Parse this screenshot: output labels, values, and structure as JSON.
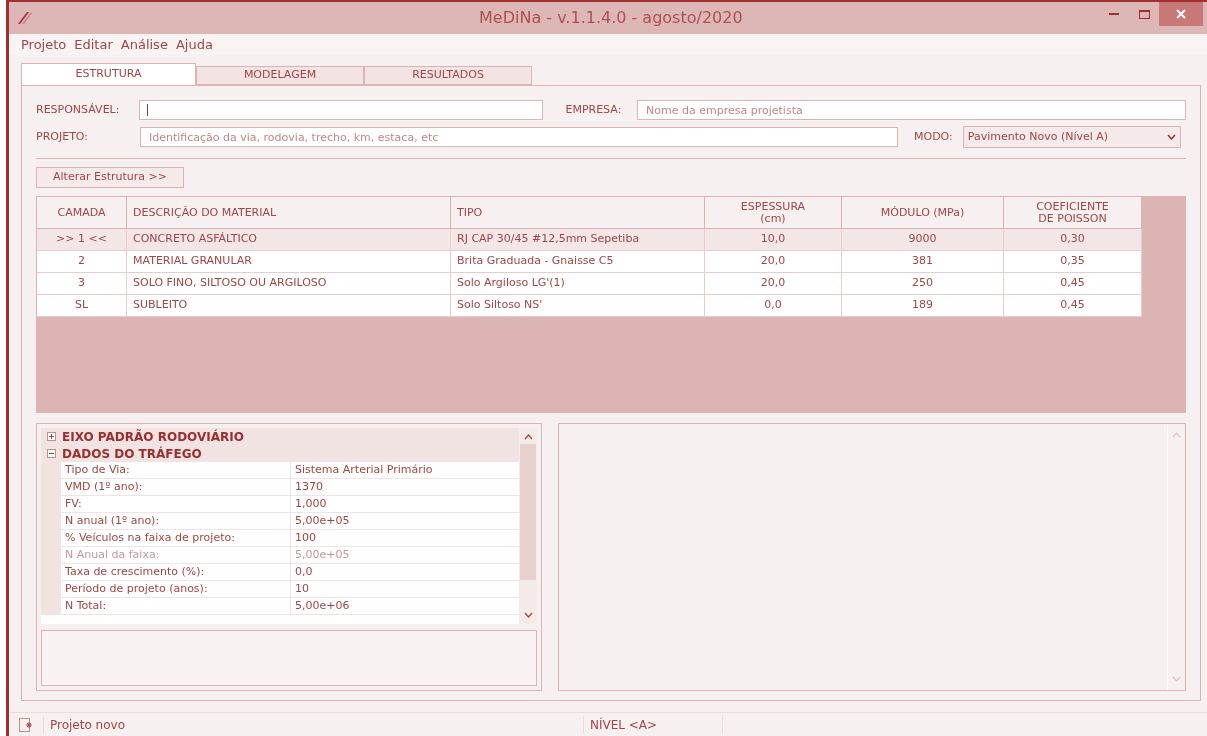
{
  "window": {
    "title": "MeDiNa - v.1.1.4.0 - agosto/2020"
  },
  "menu": [
    "Projeto",
    "Editar",
    "Análise",
    "Ajuda"
  ],
  "tabs": [
    {
      "label": "ESTRUTURA",
      "selected": true
    },
    {
      "label": "MODELAGEM",
      "selected": false
    },
    {
      "label": "RESULTADOS",
      "selected": false
    }
  ],
  "form": {
    "responsavel": {
      "label": "RESPONSÁVEL:"
    },
    "empresa": {
      "label": "EMPRESA:",
      "placeholder": "Nome da empresa projetista"
    },
    "projeto": {
      "label": "PROJETO:",
      "placeholder": "Identificação da via, rodovia, trecho, km, estaca, etc"
    },
    "modo": {
      "label": "MODO:",
      "value": "Pavimento Novo (Nível A)"
    }
  },
  "alter_button": "Alterar Estrutura >>",
  "table": {
    "columns": [
      {
        "label": "CAMADA"
      },
      {
        "label": "DESCRIÇÃO DO MATERIAL"
      },
      {
        "label": "TIPO"
      },
      {
        "label": "ESPESSURA (cm)"
      },
      {
        "label": "MÓDULO (MPa)"
      },
      {
        "label": "COEFICIENTE DE POISSON"
      }
    ],
    "rows": [
      {
        "selected": true,
        "cells": [
          ">> 1 <<",
          "CONCRETO ASFÁLTICO",
          "RJ CAP 30/45 #12,5mm Sepetiba",
          "10,0",
          "9000",
          "0,30"
        ]
      },
      {
        "selected": false,
        "cells": [
          "2",
          "MATERIAL GRANULAR",
          "Brita Graduada - Gnaisse C5",
          "20,0",
          "381",
          "0,35"
        ]
      },
      {
        "selected": false,
        "cells": [
          "3",
          "SOLO FINO, SILTOSO OU ARGILOSO",
          "Solo Argiloso LG'(1)",
          "20,0",
          "250",
          "0,45"
        ]
      },
      {
        "selected": false,
        "cells": [
          "SL",
          "SUBLEITO",
          "Solo Siltoso NS'",
          "0,0",
          "189",
          "0,45"
        ]
      }
    ]
  },
  "property_grid": [
    {
      "title": "EIXO PADRÃO RODOVIÁRIO",
      "expanded": false
    },
    {
      "title": "DADOS DO TRÁFEGO",
      "expanded": true,
      "rows": [
        {
          "name": "Tipo de Via:",
          "value": "Sistema Arterial Primário",
          "disabled": false
        },
        {
          "name": "VMD (1º ano):",
          "value": "1370",
          "disabled": false
        },
        {
          "name": "FV:",
          "value": "1,000",
          "disabled": false
        },
        {
          "name": "N anual (1º ano):",
          "value": "5,00e+05",
          "disabled": false
        },
        {
          "name": "% Veículos na faixa de projeto:",
          "value": "100",
          "disabled": false
        },
        {
          "name": "N Anual da faixa:",
          "value": "5,00e+05",
          "disabled": true
        },
        {
          "name": "Taxa de crescimento (%):",
          "value": "0,0",
          "disabled": false
        },
        {
          "name": "Período de projeto (anos):",
          "value": "10",
          "disabled": false
        },
        {
          "name": "N Total:",
          "value": "5,00e+06",
          "disabled": false
        }
      ]
    }
  ],
  "status_bar": [
    "Projeto novo",
    "NÍVEL <A>"
  ]
}
